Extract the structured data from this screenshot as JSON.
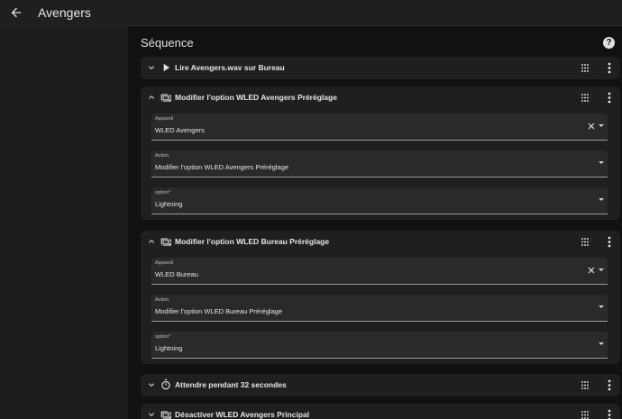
{
  "header": {
    "title": "Avengers",
    "back_icon": "arrow-left-icon"
  },
  "main": {
    "section_title": "Séquence",
    "help_icon": "help-circle-icon",
    "help_glyph": "?"
  },
  "actions": [
    {
      "title": "Lire Avengers.wav sur Bureau",
      "icon": "play-icon",
      "expanded": false
    },
    {
      "title": "Modifier l'option WLED Avengers Préréglage",
      "icon": "device-icon",
      "expanded": true,
      "fields": [
        {
          "label": "Appareil",
          "value": "WLED Avengers",
          "clearable": true
        },
        {
          "label": "Action",
          "value": "Modifier l'option WLED Avengers Préréglage",
          "clearable": false
        },
        {
          "label": "option*",
          "value": "Lightning",
          "clearable": false
        }
      ]
    },
    {
      "title": "Modifier l'option WLED Bureau Préréglage",
      "icon": "device-icon",
      "expanded": true,
      "fields": [
        {
          "label": "Appareil",
          "value": "WLED Bureau",
          "clearable": true
        },
        {
          "label": "Action",
          "value": "Modifier l'option WLED Bureau Préréglage",
          "clearable": false
        },
        {
          "label": "option*",
          "value": "Lightning",
          "clearable": false
        }
      ]
    },
    {
      "title": "Attendre pendant 32 secondes",
      "icon": "timer-icon",
      "expanded": false
    },
    {
      "title": "Désactiver WLED Avengers Principal",
      "icon": "device-icon",
      "expanded": false
    }
  ]
}
